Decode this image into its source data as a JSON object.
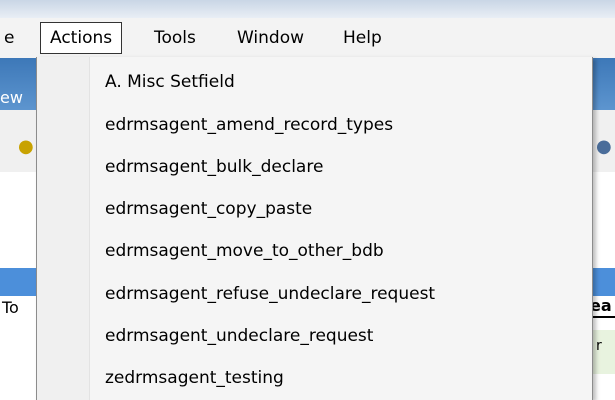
{
  "menubar": {
    "items": [
      {
        "label": "e"
      },
      {
        "label": "Actions"
      },
      {
        "label": "Tools"
      },
      {
        "label": "Window"
      },
      {
        "label": "Help"
      }
    ]
  },
  "background": {
    "bar_text": "ew",
    "panel_label": "To",
    "right_label_1": "ea",
    "right_label_2": "r"
  },
  "actions_menu": {
    "items": [
      {
        "label": "A. Misc Setfield"
      },
      {
        "label": "edrmsagent_amend_record_types"
      },
      {
        "label": "edrmsagent_bulk_declare"
      },
      {
        "label": "edrmsagent_copy_paste"
      },
      {
        "label": "edrmsagent_move_to_other_bdb"
      },
      {
        "label": "edrmsagent_refuse_undeclare_request"
      },
      {
        "label": "edrmsagent_undeclare_request"
      },
      {
        "label": "zedrmsagent_testing"
      }
    ]
  }
}
